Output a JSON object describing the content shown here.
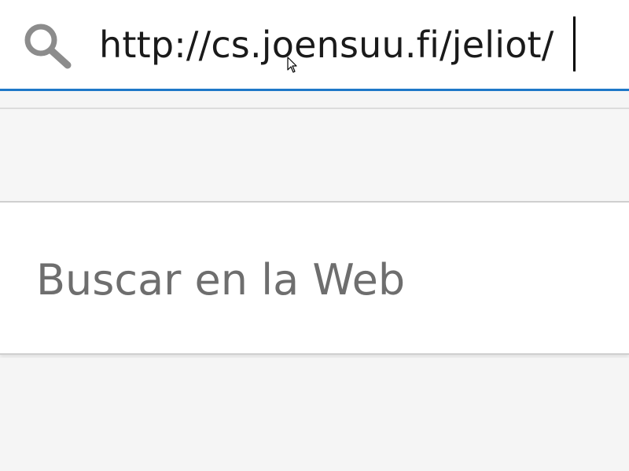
{
  "search": {
    "value": "http://cs.joensuu.fi/jeliot/",
    "icon": "search-icon",
    "accent_color": "#1e78c8"
  },
  "suggestions": [
    {
      "label": "Buscar en la Web",
      "icon": "search-icon"
    }
  ]
}
